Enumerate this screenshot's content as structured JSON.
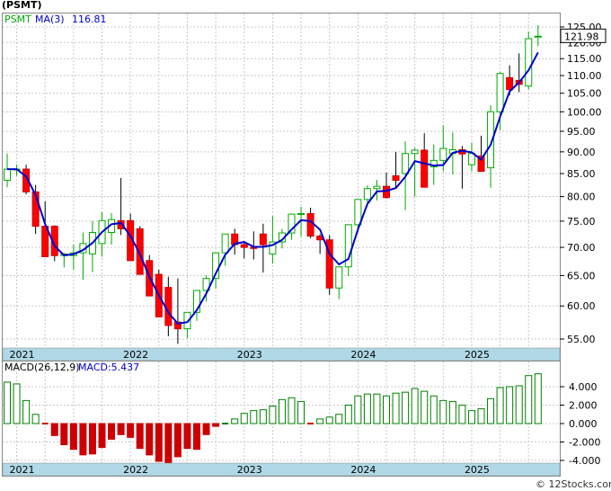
{
  "chart_data": [
    {
      "type": "candlestick",
      "title": "(PSMT)",
      "indicator_label": "MA(3)",
      "indicator_value": "116.81",
      "last_price_label": "121.98",
      "yticks": [
        "125.00",
        "120.00",
        "115.00",
        "110.00",
        "105.00",
        "100.00",
        "95.00",
        "90.00",
        "85.00",
        "80.00",
        "75.00",
        "70.00",
        "65.00",
        "60.00",
        "55.00"
      ],
      "ylim": [
        53.5,
        126.5
      ],
      "xticks": [
        "2021",
        "2022",
        "2023",
        "2024",
        "2025"
      ],
      "log_scale": true,
      "grid": true,
      "colors": {
        "up": "#00aa00",
        "down": "#ff0000",
        "ma": "#0000cc",
        "axis_band": "#b0d8e6",
        "grid": "#c8c8c8"
      },
      "x": [
        "2020-12",
        "2021-01",
        "2021-02",
        "2021-03",
        "2021-04",
        "2021-05",
        "2021-06",
        "2021-07",
        "2021-08",
        "2021-09",
        "2021-10",
        "2021-11",
        "2021-12",
        "2022-01",
        "2022-02",
        "2022-03",
        "2022-04",
        "2022-05",
        "2022-06",
        "2022-07",
        "2022-08",
        "2022-09",
        "2022-10",
        "2022-11",
        "2022-12",
        "2023-01",
        "2023-02",
        "2023-03",
        "2023-04",
        "2023-05",
        "2023-06",
        "2023-07",
        "2023-08",
        "2023-09",
        "2023-10",
        "2023-11",
        "2023-12",
        "2024-01",
        "2024-02",
        "2024-03",
        "2024-04",
        "2024-05",
        "2024-06",
        "2024-07",
        "2024-08",
        "2024-09",
        "2024-10",
        "2024-11",
        "2024-12",
        "2025-01",
        "2025-02",
        "2025-03",
        "2025-04",
        "2025-05",
        "2025-06",
        "2025-07",
        "2025-08"
      ],
      "open": [
        83.5,
        86,
        86,
        81,
        74,
        74,
        68.5,
        68.5,
        69,
        68.8,
        70.7,
        72.8,
        75.1,
        75.1,
        73.5,
        67.6,
        65.2,
        63,
        57.5,
        56.5,
        59,
        62.5,
        64.5,
        69,
        72.5,
        70.5,
        70,
        72.5,
        68.8,
        71,
        72.7,
        76.4,
        76.5,
        72.1,
        71.4,
        62.9,
        66.5,
        74.3,
        79.4,
        81.7,
        82.2,
        84.5,
        85,
        89.6,
        90.4,
        86.5,
        88,
        89.6,
        90.5,
        87,
        89,
        86.3,
        100,
        109.4,
        108.6,
        107,
        122
      ],
      "high": [
        89.6,
        87,
        87,
        82.5,
        79,
        74.2,
        69,
        70.5,
        72.8,
        75,
        76.8,
        76.6,
        84,
        76.5,
        74,
        68.6,
        66,
        64.8,
        64.5,
        58.5,
        62.5,
        65,
        67,
        72.5,
        73.5,
        71,
        73,
        74.5,
        76,
        73.5,
        74.3,
        77.9,
        77.7,
        72.5,
        72.3,
        63.9,
        68.7,
        79.2,
        82.4,
        83.6,
        85.2,
        90,
        92.5,
        91,
        94.5,
        91.8,
        96.5,
        94.7,
        91.4,
        92.2,
        93.9,
        101.7,
        111,
        113,
        116.6,
        123.5,
        125.6
      ],
      "low": [
        82,
        84.5,
        80.5,
        72.5,
        70,
        67.5,
        66.4,
        66,
        64.3,
        65.6,
        68.3,
        70.5,
        72.3,
        73,
        66.7,
        63.5,
        61.2,
        55.4,
        54.3,
        55.1,
        57.7,
        60.7,
        62.8,
        66.7,
        68.7,
        68,
        67.8,
        65.5,
        67.1,
        69.8,
        71.4,
        72,
        71.7,
        68.8,
        61.8,
        61.1,
        64.9,
        72.8,
        78.5,
        79.2,
        79.6,
        82,
        77.2,
        80,
        82.1,
        82.5,
        85.5,
        84.8,
        81.7,
        85.5,
        86.4,
        81.9,
        95.3,
        104.4,
        105.3,
        106.1,
        118.9
      ],
      "close": [
        86,
        86,
        81,
        74,
        68.3,
        68.5,
        68.8,
        69,
        70.7,
        72.8,
        75.1,
        75.3,
        73.5,
        67.6,
        65.2,
        61.6,
        58.3,
        57,
        56.5,
        59,
        62.5,
        64.5,
        69,
        72.5,
        70.5,
        70,
        69.8,
        70.5,
        71,
        72.7,
        76.4,
        76.5,
        72.1,
        71.4,
        62.9,
        66.5,
        74.3,
        79.4,
        81.7,
        82.2,
        79.8,
        83.5,
        89.6,
        90.4,
        82,
        88,
        90.8,
        90.5,
        89.5,
        89.6,
        85.5,
        100,
        110.6,
        106,
        107.5,
        121.2,
        122
      ]
    },
    {
      "type": "bar",
      "title": "MACD(26,12,9)",
      "indicator_label": "MACD:5.437",
      "yticks": [
        "4.000",
        "2.000",
        "0.000",
        "-2.000",
        "-4.000"
      ],
      "ylim": [
        -4.3,
        5.3
      ],
      "xticks": [
        "2021",
        "2022",
        "2023",
        "2024",
        "2025"
      ],
      "grid": true,
      "colors": {
        "positive": "#008000",
        "negative": "#cc0000"
      },
      "values": [
        4.5,
        4.3,
        2.5,
        1.0,
        -0.1,
        -1.3,
        -2.3,
        -2.8,
        -3.4,
        -3.3,
        -2.6,
        -1.7,
        -1.2,
        -1.5,
        -2.7,
        -3.4,
        -4.1,
        -4.4,
        -3.6,
        -2.7,
        -2.8,
        -1.2,
        -0.3,
        0.1,
        0.5,
        1.1,
        1.4,
        1.5,
        1.9,
        2.6,
        2.8,
        2.4,
        -0.2,
        0.5,
        0.7,
        1.0,
        2.0,
        3.0,
        3.2,
        3.2,
        3.0,
        3.3,
        3.4,
        3.8,
        3.5,
        3.0,
        2.5,
        2.4,
        2.0,
        1.4,
        1.6,
        2.7,
        3.9,
        4.0,
        4.1,
        5.2,
        5.4
      ]
    }
  ],
  "footer": {
    "watermark": "© 12Stocks.com"
  }
}
